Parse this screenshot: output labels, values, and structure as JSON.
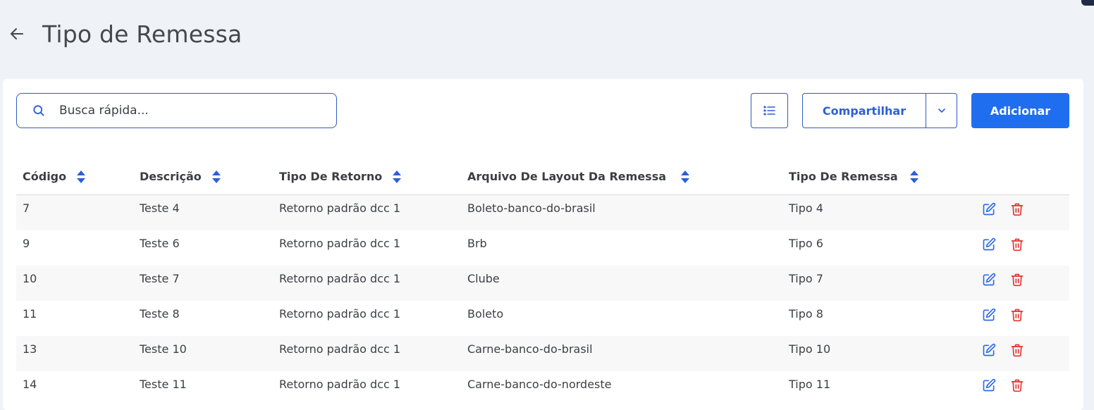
{
  "header": {
    "title": "Tipo de Remessa"
  },
  "toolbar": {
    "search_placeholder": "Busca rápida...",
    "share_label": "Compartilhar",
    "add_label": "Adicionar"
  },
  "table": {
    "columns": [
      "Código",
      "Descrição",
      "Tipo De Retorno",
      "Arquivo De Layout Da Remessa",
      "Tipo De Remessa"
    ],
    "rows": [
      [
        "7",
        "Teste 4",
        "Retorno padrão dcc 1",
        "Boleto-banco-do-brasil",
        "Tipo 4"
      ],
      [
        "9",
        "Teste 6",
        "Retorno padrão dcc 1",
        "Brb",
        "Tipo 6"
      ],
      [
        "10",
        "Teste 7",
        "Retorno padrão dcc 1",
        "Clube",
        "Tipo 7"
      ],
      [
        "11",
        "Teste 8",
        "Retorno padrão dcc 1",
        "Boleto",
        "Tipo 8"
      ],
      [
        "13",
        "Teste 10",
        "Retorno padrão dcc 1",
        "Carne-banco-do-brasil",
        "Tipo 10"
      ],
      [
        "14",
        "Teste 11",
        "Retorno padrão dcc 1",
        "Carne-banco-do-nordeste",
        "Tipo 11"
      ]
    ]
  },
  "colors": {
    "accent": "#1f6ef0",
    "border": "#2f5bbd",
    "delete": "#e3342f",
    "edit": "#2b6be8"
  },
  "icons": {
    "back": "arrow-left-icon",
    "search": "search-icon",
    "list": "list-icon",
    "caret": "chevron-down-icon",
    "edit": "edit-icon",
    "delete": "trash-icon",
    "sort": "sort-icon"
  }
}
